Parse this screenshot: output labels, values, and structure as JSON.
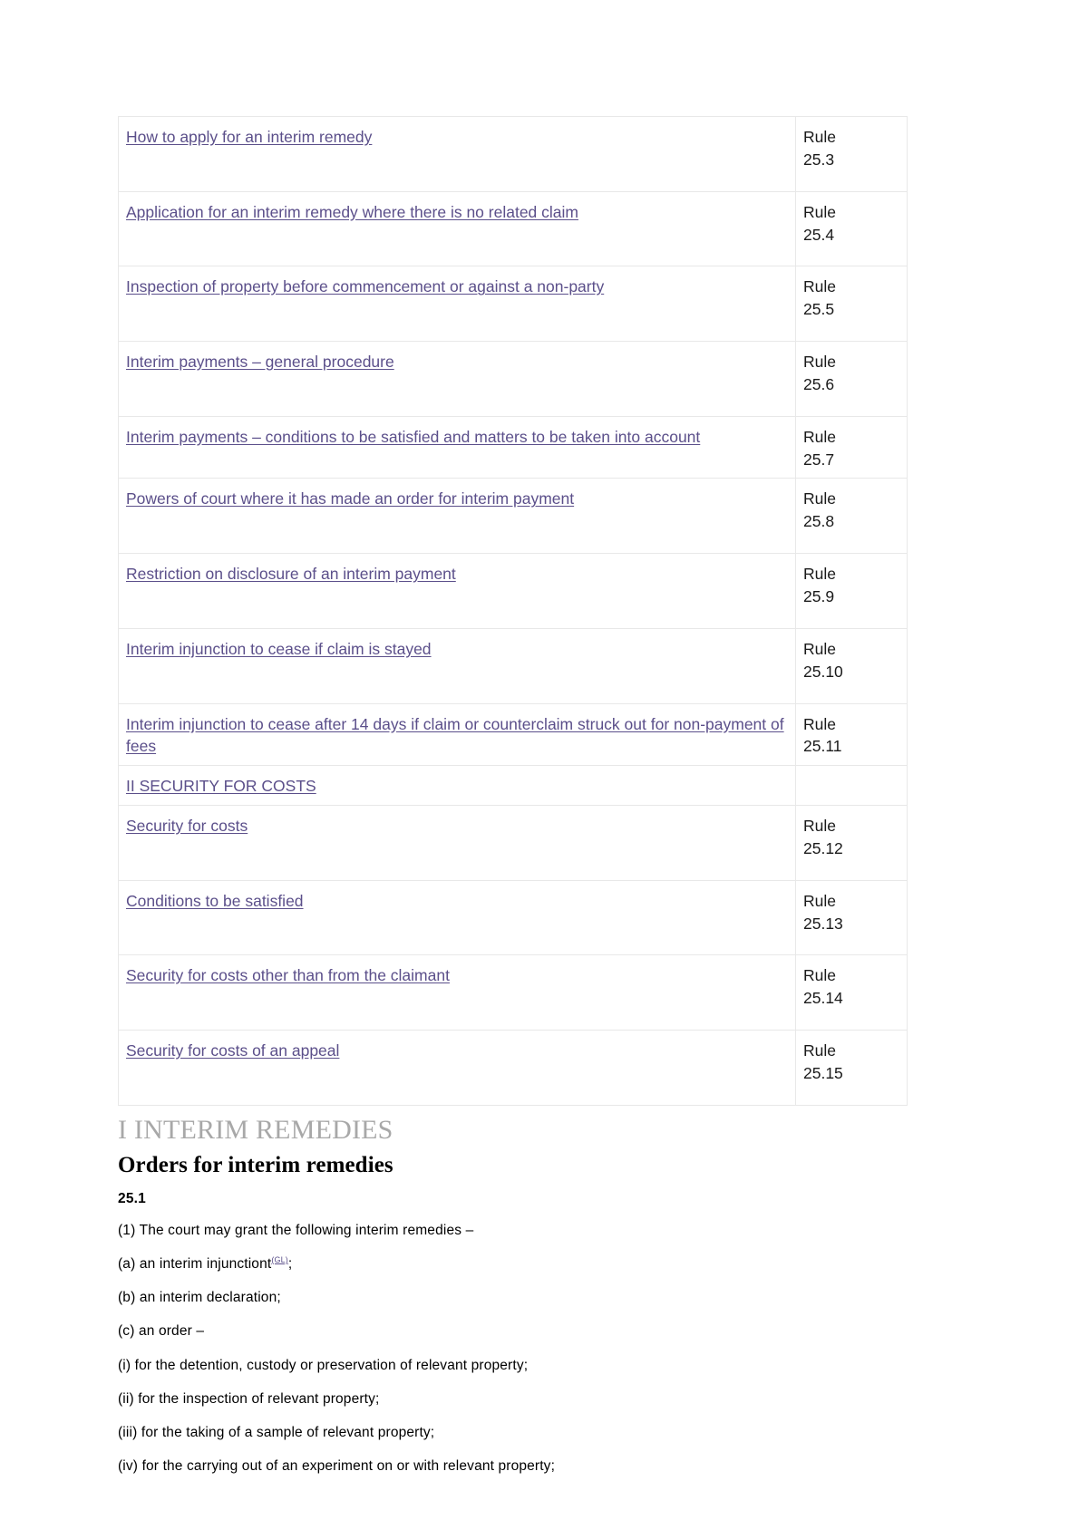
{
  "contents_table": {
    "rows": [
      {
        "title": "How to apply for an interim remedy",
        "rule": "Rule",
        "rule_num": "25.3"
      },
      {
        "title": "Application for an interim remedy where there is no related claim ",
        "rule": "Rule",
        "rule_num": "25.4"
      },
      {
        "title": "Inspection of property before commencement or against a non-party",
        "rule": "Rule",
        "rule_num": "25.5"
      },
      {
        "title": "Interim payments – general procedure",
        "rule": "Rule",
        "rule_num": "25.6"
      },
      {
        "title": "Interim payments – conditions to be satisfied and matters to be taken into account",
        "rule": "Rule",
        "rule_num": "25.7"
      },
      {
        "title": "Powers of court where it has made an order for interim payment",
        "rule": "Rule",
        "rule_num": "25.8"
      },
      {
        "title": "Restriction on disclosure of an interim payment",
        "rule": "Rule",
        "rule_num": "25.9"
      },
      {
        "title": "Interim injunction to cease if claim is stayed",
        "rule": "Rule",
        "rule_num": "25.10"
      },
      {
        "title": "Interim injunction to cease after 14 days if claim or counterclaim struck out for non-payment of fees",
        "rule": "Rule",
        "rule_num": "25.11"
      },
      {
        "title": "II SECURITY FOR COSTS",
        "rule": "",
        "rule_num": ""
      },
      {
        "title": "Security for costs",
        "rule": "Rule",
        "rule_num": "25.12"
      },
      {
        "title": "Conditions to be satisfied",
        "rule": "Rule",
        "rule_num": "25.13"
      },
      {
        "title": "Security for costs other than from the claimant",
        "rule": "Rule",
        "rule_num": "25.14"
      },
      {
        "title": "Security for costs of an appeal",
        "rule": "Rule",
        "rule_num": "25.15"
      }
    ]
  },
  "section": {
    "heading": "I INTERIM REMEDIES",
    "sub_heading": "Orders for interim remedies",
    "rule_number": "25.1",
    "paragraphs": [
      {
        "text": "(1) The court may grant the following interim remedies –",
        "gl": false
      },
      {
        "text": "(a) an interim injunctiont",
        "gl": true,
        "gl_label": "(GL)",
        "suffix": ";"
      },
      {
        "text": "(b) an interim declaration;",
        "gl": false
      },
      {
        "text": "(c) an order –",
        "gl": false
      },
      {
        "text": "(i) for the detention, custody or preservation of relevant property;",
        "gl": false
      },
      {
        "text": "(ii) for the inspection of relevant property;",
        "gl": false
      },
      {
        "text": "(iii) for the taking of a sample of relevant property;",
        "gl": false
      },
      {
        "text": "(iv) for the carrying out of an experiment on or with relevant property;",
        "gl": false
      }
    ]
  },
  "colors": {
    "link": "#5b4f8a",
    "section_heading": "#a8a8a8",
    "border": "#e8e8e8"
  }
}
